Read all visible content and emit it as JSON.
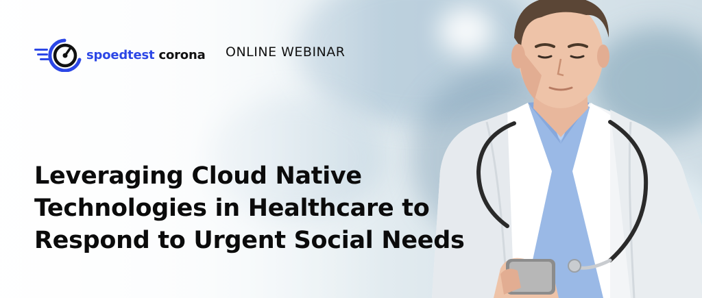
{
  "brand": {
    "name_part1": "spoedtest",
    "name_part2": "corona",
    "accent_color": "#2c47e6",
    "logo_icon": "speedometer-icon"
  },
  "event": {
    "label": "ONLINE WEBINAR"
  },
  "headline": {
    "lines": [
      "Leveraging Cloud Native",
      "Technologies in Healthcare to",
      "Respond to Urgent Social Needs"
    ]
  },
  "image": {
    "subject": "doctor-with-phone-illustration"
  }
}
